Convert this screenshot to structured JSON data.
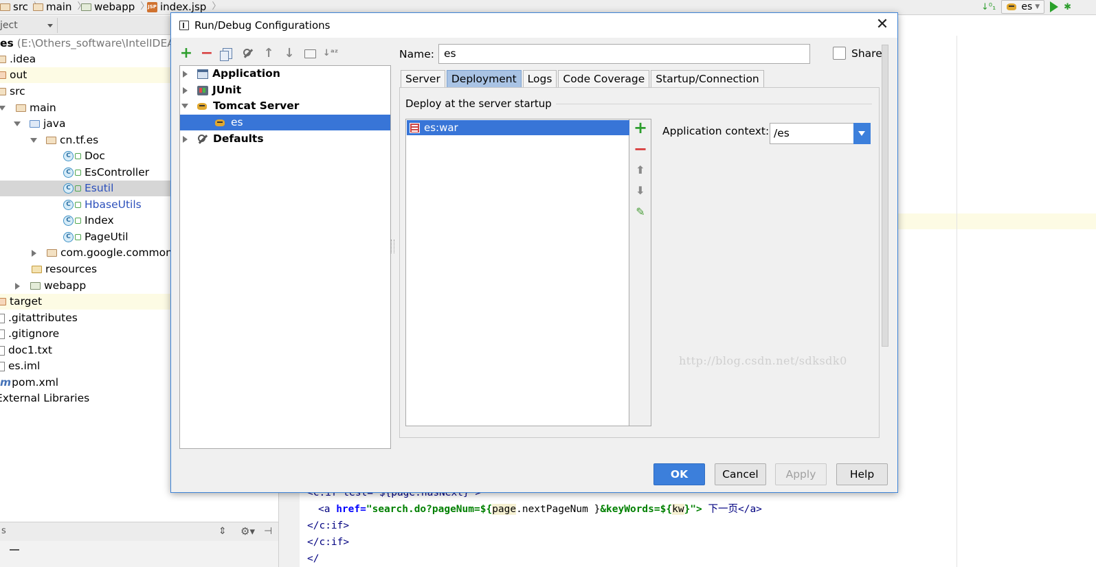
{
  "ide": {
    "breadcrumb": [
      "src",
      "main",
      "webapp",
      "index.jsp"
    ],
    "project_combo": "ject",
    "run_config": "es",
    "tree": [
      {
        "label": "es",
        "path": "(E:\\Others_software\\IntelIDEA\\wo"
      },
      {
        "label": ".idea"
      },
      {
        "label": "out"
      },
      {
        "label": "src"
      },
      {
        "label": "main"
      },
      {
        "label": "java"
      },
      {
        "label": "cn.tf.es"
      },
      {
        "label": "Doc"
      },
      {
        "label": "EsController"
      },
      {
        "label": "Esutil"
      },
      {
        "label": "HbaseUtils"
      },
      {
        "label": "Index"
      },
      {
        "label": "PageUtil"
      },
      {
        "label": "com.google.common."
      },
      {
        "label": "resources"
      },
      {
        "label": "webapp"
      },
      {
        "label": "target"
      },
      {
        "label": ".gitattributes"
      },
      {
        "label": ".gitignore"
      },
      {
        "label": "doc1.txt"
      },
      {
        "label": "es.iml"
      },
      {
        "label": "pom.xml"
      },
      {
        "label": "External Libraries"
      }
    ],
    "bottom_panel_label": "s",
    "code_lines": {
      "line1_a": "<c:if test=\"${page.hasNext}\">",
      "line2_open": "<a ",
      "line2_href": "href=",
      "line2_val": "\"search.do?pageNum=${",
      "line2_el1": "page",
      "line2_mid": ".nextPageNum }",
      "line2_kw": "&keyWords=${",
      "line2_el2": "kw",
      "line2_end": "}\">",
      "line2_text": " 下一页</a>",
      "line3": "</c:if>",
      "line4": "</c:if>",
      "line5": "</"
    }
  },
  "dialog": {
    "title": "Run/Debug Configurations",
    "close_label": "✕",
    "name_label": "Name:",
    "name_value": "es",
    "share_label": "Share",
    "config_tree": [
      {
        "label": "Application"
      },
      {
        "label": "JUnit"
      },
      {
        "label": "Tomcat Server"
      },
      {
        "label": "es"
      },
      {
        "label": "Defaults"
      }
    ],
    "tabs": [
      "Server",
      "Deployment",
      "Logs",
      "Code Coverage",
      "Startup/Connection"
    ],
    "active_tab": "Deployment",
    "group_title": "Deploy at the server startup",
    "artifacts": [
      "es:war"
    ],
    "app_context_label": "Application context:",
    "app_context_value": "/es",
    "watermark": "http://blog.csdn.net/sdksdk0",
    "buttons": {
      "ok": "OK",
      "cancel": "Cancel",
      "apply": "Apply",
      "help": "Help"
    }
  },
  "colors": {
    "accent": "#3c7fdb",
    "selection": "#3875d7",
    "active_tab": "#a9c3e4",
    "add_green": "#2e9e2e",
    "remove_red": "#d83c3c"
  }
}
